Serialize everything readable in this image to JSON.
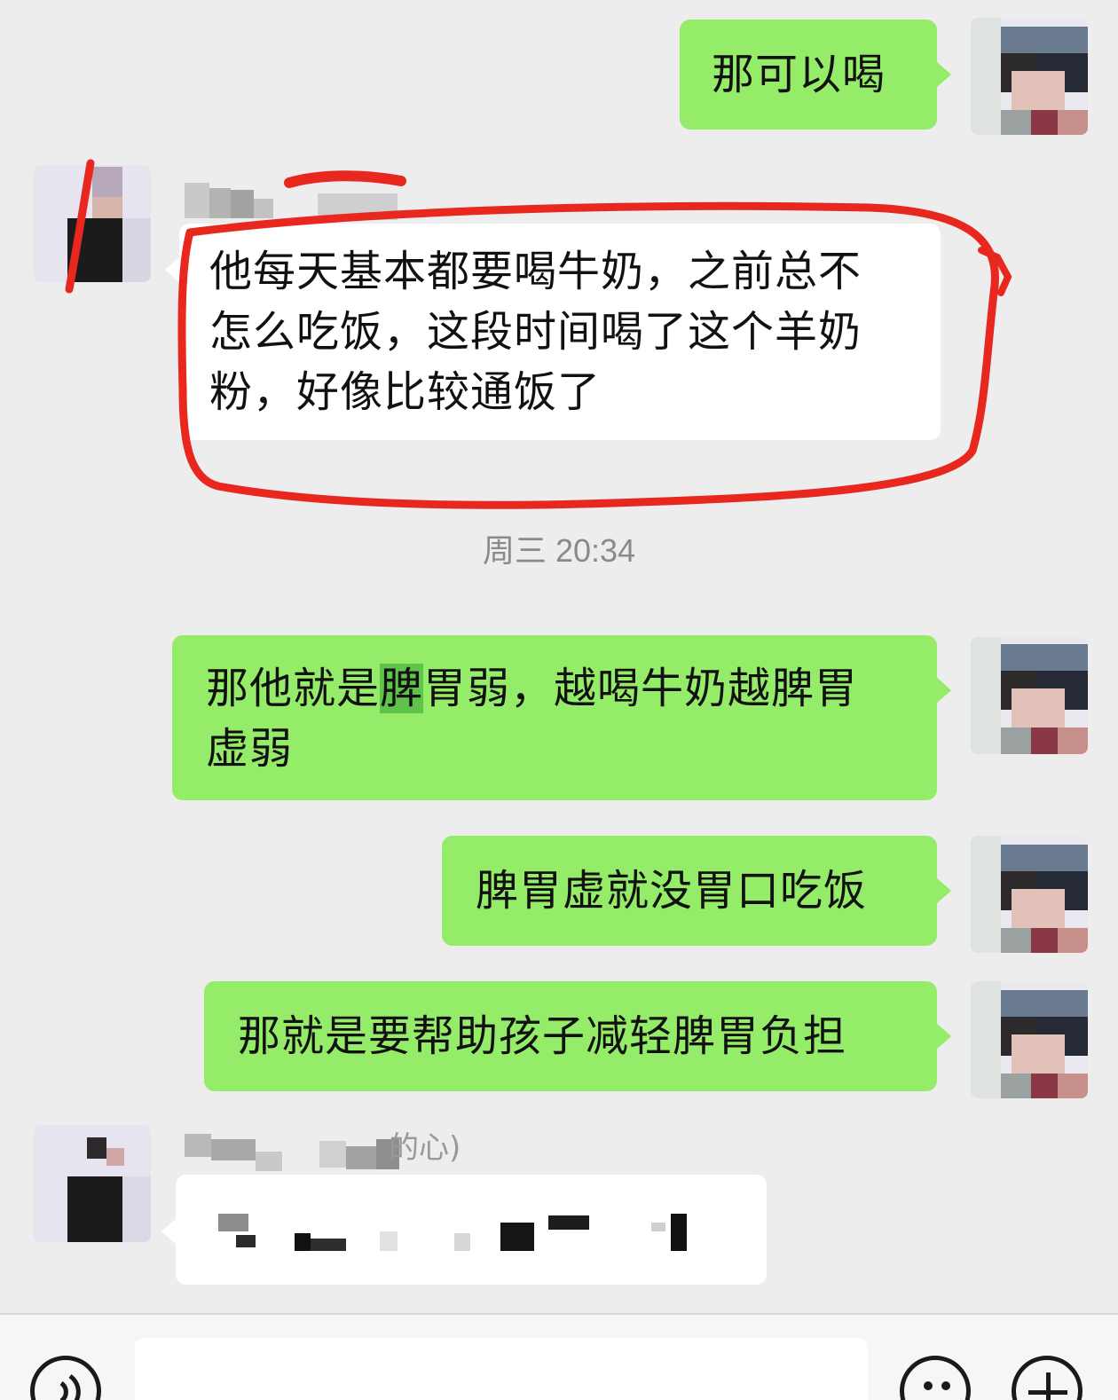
{
  "messages": [
    {
      "id": "m1",
      "side": "out",
      "lines": [
        "那可以喝"
      ]
    },
    {
      "id": "m2",
      "side": "in",
      "lines": [
        "他每天基本都要喝牛奶，之前总不",
        "怎么吃饭，这段时间喝了这个羊奶",
        "粉，好像比较通饭了"
      ]
    },
    {
      "id": "m3",
      "side": "out",
      "pre": "那他就是",
      "hl": "脾",
      "post": "胃弱，越喝牛奶越脾胃",
      "line2": "虚弱"
    },
    {
      "id": "m4",
      "side": "out",
      "lines": [
        "脾胃虚就没胃口吃饭"
      ]
    },
    {
      "id": "m5",
      "side": "out",
      "lines": [
        "那就是要帮助孩子减轻脾胃负担"
      ]
    }
  ],
  "timestamp": "周三 20:34",
  "sender_name_tail": "的心)",
  "colors": {
    "background": "#ededed",
    "bubble_out": "#95ec69",
    "bubble_in": "#ffffff",
    "annotation_red": "#e8281e"
  },
  "icons": {
    "voice": "voice-icon",
    "emoji": "emoji-icon",
    "plus": "plus-icon"
  }
}
